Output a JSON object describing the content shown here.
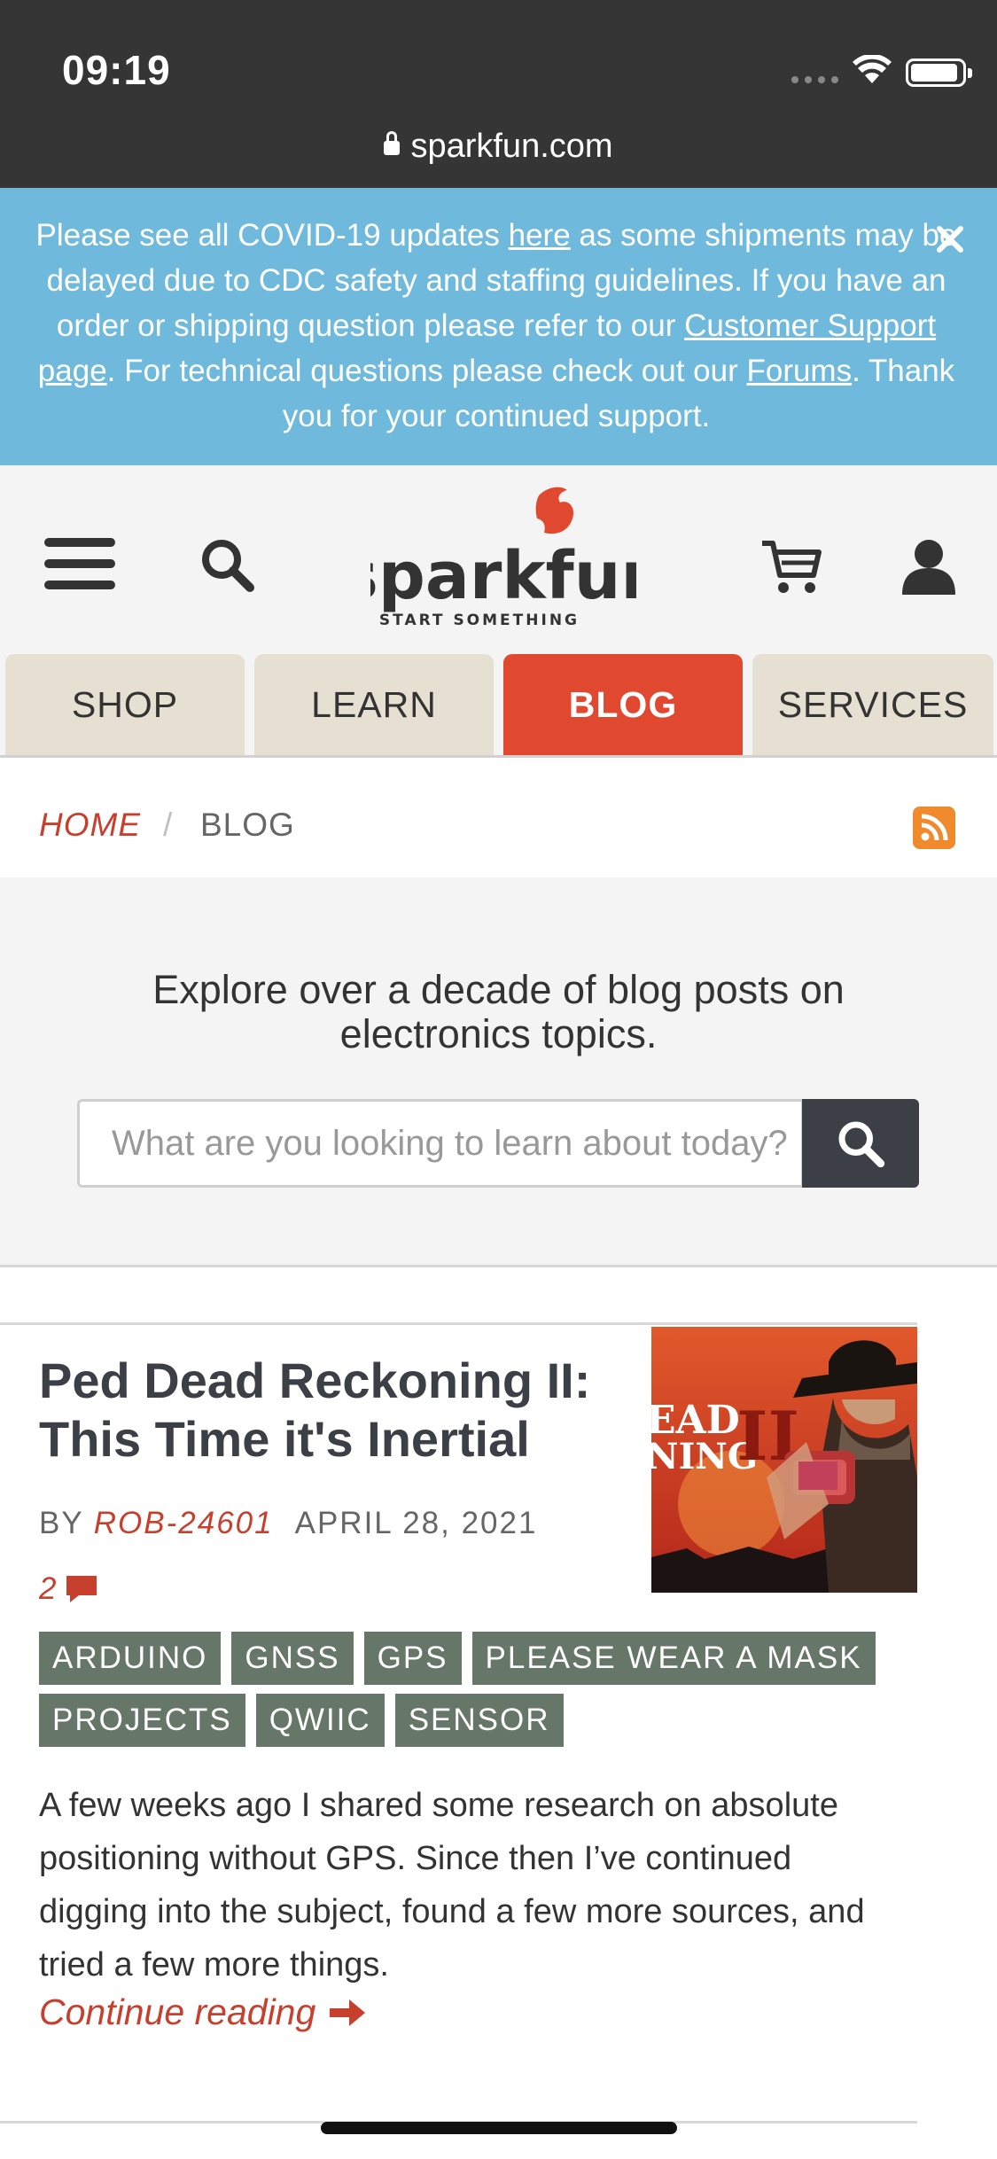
{
  "status_bar": {
    "time": "09:19",
    "url": "sparkfun.com"
  },
  "banner": {
    "part1": "Please see all COVID-19 updates ",
    "link_here": "here",
    "part2": " as some shipments may be delayed due to CDC safety and staffing guidelines. If you have an order or shipping question please refer to our ",
    "link_support": "Customer Support page",
    "part3": ". For technical questions please check out our ",
    "link_forums": "Forums",
    "part4": ". Thank you for your continued support."
  },
  "header": {
    "logo_word": "sparkfun",
    "logo_tagline": "START SOMETHING",
    "tabs": [
      {
        "label": "SHOP"
      },
      {
        "label": "LEARN"
      },
      {
        "label": "BLOG"
      },
      {
        "label": "SERVICES"
      }
    ]
  },
  "breadcrumb": {
    "home": "HOME",
    "separator": "/",
    "current": "BLOG"
  },
  "explore": {
    "text": "Explore over a decade of blog posts on electronics topics.",
    "search_placeholder": "What are you looking to learn about today?"
  },
  "post": {
    "title": "Ped Dead Reckoning II: This Time it's Inertial",
    "by": "BY ",
    "author": "ROB-24601",
    "date": "APRIL 28, 2021",
    "comment_count": "2",
    "thumb_text_1": "EAD",
    "thumb_text_2": "NING",
    "thumb_numeral": "II",
    "tags": [
      "ARDUINO",
      "GNSS",
      "GPS",
      "PLEASE WEAR A MASK",
      "PROJECTS",
      "QWIIC",
      "SENSOR"
    ],
    "excerpt": "A few weeks ago I shared some research on absolute positioning without GPS. Since then I’ve continued digging into the subject, found a few more sources, and tried a few more things.",
    "continue": "Continue reading"
  },
  "colors": {
    "brand_red": "#e0492f",
    "banner_blue": "#6fbadc",
    "tag_gray": "#667668",
    "link_red": "#c7402e"
  }
}
